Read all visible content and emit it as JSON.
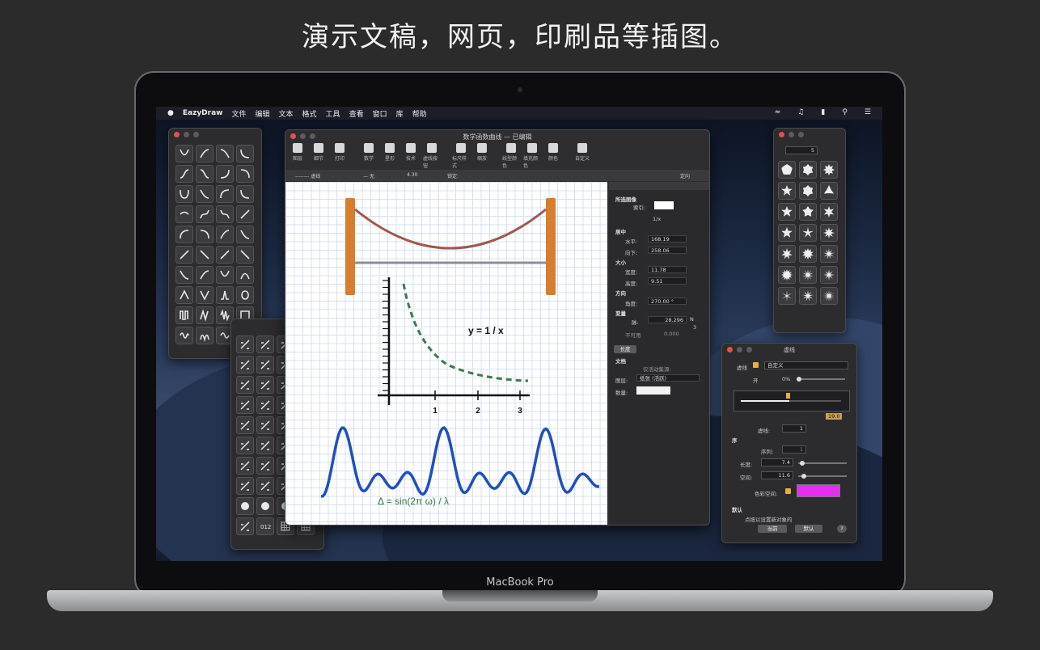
{
  "headline": "演示文稿，网页，印刷品等插图。",
  "laptop_brand": "MacBook Pro",
  "menubar": {
    "app": "EazyDraw",
    "items": [
      "文件",
      "编辑",
      "文本",
      "格式",
      "工具",
      "查看",
      "窗口",
      "库",
      "帮助"
    ]
  },
  "main_window": {
    "title": "数学函数曲线 — 已编辑",
    "toolbar": [
      "图层",
      "细节",
      "打印",
      "数学",
      "星形",
      "技术",
      "虚线按钮",
      "标尺样式",
      "缩放",
      "线型颜色",
      "填充颜色",
      "颜色",
      "自定义"
    ],
    "options": {
      "line_style": "虚线",
      "arrow": "无",
      "width": "4.30",
      "lock": "锁定:",
      "direction": "定向"
    }
  },
  "drawing": {
    "formula_recip": "y = 1 / x",
    "ticks": [
      "1",
      "2",
      "3"
    ],
    "formula_wave": "Δ = sin(2π ω) / λ"
  },
  "inspector": {
    "selected_image": "所选图像",
    "index_label": "索引:",
    "shape_name": "1/x",
    "center": "居中",
    "horizontal_label": "水平:",
    "horizontal": "168.19",
    "down_label": "向下:",
    "down": "258.06",
    "size": "大小",
    "width_label": "宽度:",
    "width": "11.78",
    "height_label": "高度:",
    "height": "9.51",
    "direction": "方向",
    "angle_label": "角度:",
    "angle": "270.00 °",
    "variables": "变量",
    "var_label": "脉:",
    "var_value": "28.296",
    "var_n": "N",
    "var_n_value": "3",
    "disabled_label": "不可用",
    "disabled_value": "0.000",
    "length_btn": "长度",
    "doc": "文档",
    "auto_update": "仅活动集源:",
    "layer_label": "图层:",
    "layer_value": "纸张 (活跃)",
    "count_label": "数量:"
  },
  "shape_panel": {
    "count": "5"
  },
  "dash_panel": {
    "title": "虚线",
    "dash_label": "虚线",
    "dash_value": "自定义",
    "open_label": "开",
    "open_value": "0%",
    "end_value": "19.0",
    "dash_count_label": "虚线:",
    "dash_count": "1",
    "sequence": "序",
    "seq_label": "序列:",
    "seq_value": "1",
    "length_label": "长度:",
    "length_value": "7.4",
    "space_label": "空间:",
    "space_value": "11.6",
    "color_space_label": "色彩空间:",
    "color_space_swatch": "#e62ef0",
    "default": "默认",
    "default_hint": "点按以设置新对象的",
    "current_btn": "当前",
    "default_btn": "默认",
    "help": "?"
  },
  "colors": {
    "bridge_post": "#d77d2e",
    "rope": "#a0584c",
    "recip_curve": "#3d7a4c",
    "wave": "#1f4fc0",
    "formula_green": "#2f7a3a"
  }
}
